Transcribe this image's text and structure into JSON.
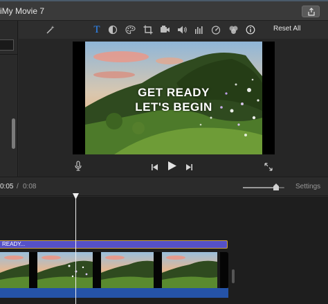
{
  "window": {
    "title": "iMy Movie 7"
  },
  "toolbar": {
    "reset_all_label": "Reset All",
    "tools": [
      "magic-wand-icon",
      "title-text-icon",
      "color-balance-icon",
      "color-palette-icon",
      "crop-icon",
      "stabilization-icon",
      "volume-icon",
      "equalizer-icon",
      "speed-icon",
      "clip-filter-icon",
      "info-icon"
    ],
    "active_tool": "title-text-icon",
    "active_color": "#2f8cff"
  },
  "viewer": {
    "overlay_lines": [
      "GET READY",
      "LET'S BEGIN"
    ]
  },
  "timecode": {
    "current": "0:05",
    "separator": "/",
    "total": "0:08"
  },
  "zoom": {
    "level_fraction": 0.8
  },
  "settings_label": "Settings",
  "timeline": {
    "title_clip_label": "READY...",
    "title_clip_color": "#5550c7",
    "audio_color": "#2553a8",
    "selection_border": "#c9a13a"
  }
}
